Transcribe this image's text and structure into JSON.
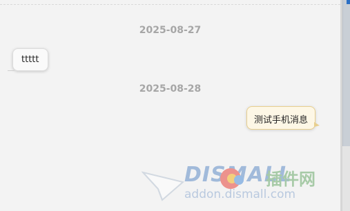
{
  "chat": {
    "messages": [
      {
        "date": "2025-08-27",
        "text": "ttttt",
        "direction": "incoming"
      },
      {
        "date": "2025-08-28",
        "text": "测试手机消息",
        "direction": "outgoing"
      }
    ]
  },
  "watermark": {
    "logo_text": "DISMALL",
    "cn_text": "插件网",
    "url": "addon.dismall.com"
  },
  "colors": {
    "background": "#f3f3f3",
    "date_text": "#a6a6a6",
    "incoming_bubble": "#fafafa",
    "outgoing_bubble": "#fdf7e6",
    "outgoing_border": "#e8cf8e",
    "scroll_accent": "#2b6fc4"
  }
}
